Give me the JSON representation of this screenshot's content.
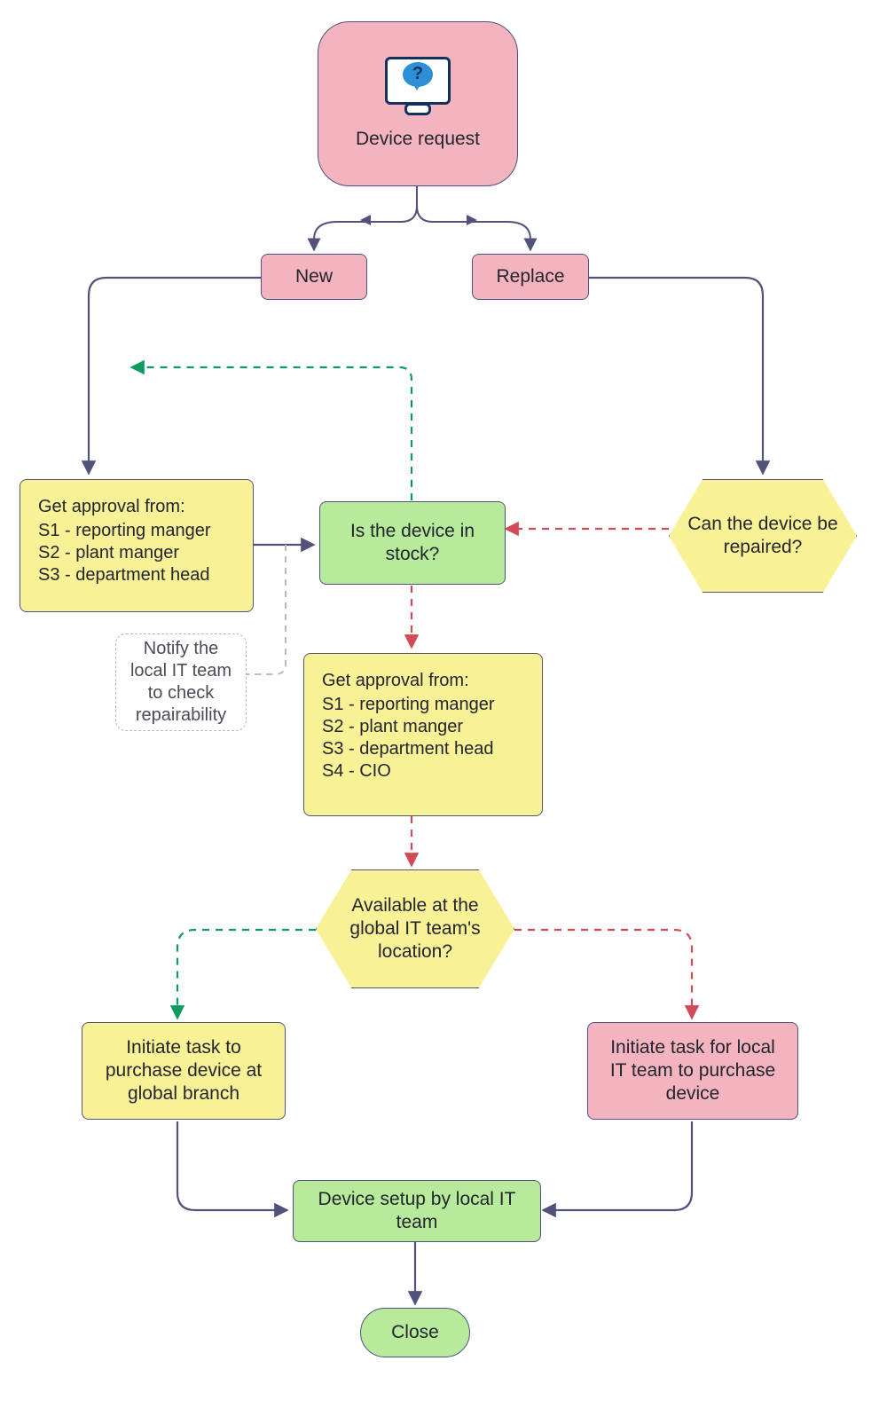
{
  "colors": {
    "pink": "#f3b3bf",
    "yellow": "#f9f195",
    "green": "#b7ea9a",
    "blue": "#50527c",
    "red": "#d24a55",
    "greenLine": "#0f9a60",
    "grey": "#b9b9bf"
  },
  "nodes": {
    "start": {
      "label": "Device request"
    },
    "new": {
      "label": "New"
    },
    "replace": {
      "label": "Replace"
    },
    "approval1": {
      "title": "Get approval from:",
      "lines": [
        "S1 - reporting manger",
        "S2 - plant manger",
        "S3 - department head"
      ]
    },
    "inStock": {
      "label": "Is the device in stock?"
    },
    "repair": {
      "label": "Can the device be repaired?"
    },
    "notifyNote": {
      "label": "Notify the local IT team to check repairability"
    },
    "approval2": {
      "title": "Get approval from:",
      "lines": [
        "S1 - reporting manger",
        "S2 - plant manger",
        "S3 - department head",
        "S4 - CIO"
      ]
    },
    "globalLoc": {
      "label": "Available at the global IT team's location?"
    },
    "taskGlobal": {
      "label": "Initiate task to purchase device at global branch"
    },
    "taskLocal": {
      "label": "Initiate task for local IT team to purchase device"
    },
    "setup": {
      "label": "Device setup by local IT team"
    },
    "close": {
      "label": "Close"
    }
  }
}
